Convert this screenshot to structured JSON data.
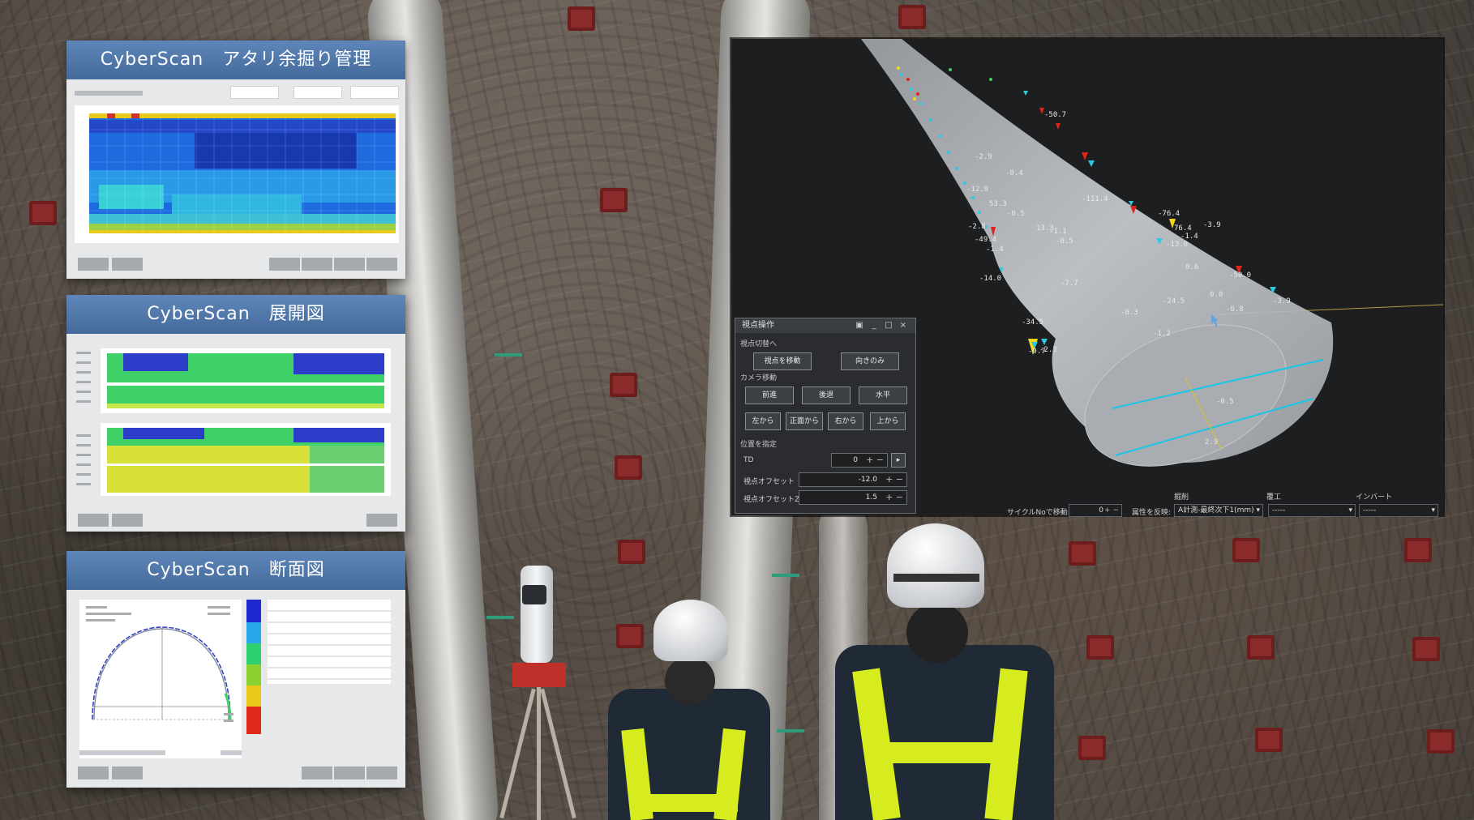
{
  "panels": {
    "management": {
      "title": "CyberScan　アタリ余掘り管理"
    },
    "development": {
      "title": "CyberScan　展開図"
    },
    "section": {
      "title": "CyberScan　断面図"
    }
  },
  "viewer": {
    "labels": [
      "-50.7",
      "-2.9",
      "-0.4",
      "-111.4",
      "-76.4",
      "53.3",
      "-0.5",
      "-3.9",
      "13.3",
      "-1.1",
      "-0.5",
      "-13.0",
      "76.4",
      "-1.4",
      "-12.9",
      "-2.8",
      "-49.4",
      "-1.4",
      "-14.0",
      "-7.7",
      "-24.5",
      "0.6",
      "-50.0",
      "0.0",
      "-3.9",
      "-6.8",
      "-0.3",
      "-1.2",
      "-34.5",
      "-9.7",
      "-2.3",
      "-0.5",
      "2.9"
    ],
    "header_labels": {
      "h1": "掘削",
      "h2": "覆工",
      "h3": "インバート"
    }
  },
  "control": {
    "title": "視点操作",
    "section_switch": "視点切替へ",
    "btn_move_view": "視点を移動",
    "btn_orient_only": "向きのみ",
    "section_camera": "カメラ移動",
    "btn_forward": "前進",
    "btn_back": "後退",
    "btn_level": "水平",
    "btn_left": "左から",
    "btn_front": "正面から",
    "btn_right": "右から",
    "btn_top": "上から",
    "section_position": "位置を指定",
    "td_label": "TD",
    "td_value": "0",
    "offset_label": "視点オフセット",
    "offset_value": "-12.0",
    "offsetz_label": "視点オフセットZ",
    "offsetz_value": "1.5"
  },
  "statusbar": {
    "cycle_label": "サイクルNoで移動:",
    "cycle_value": "0",
    "attr_label": "属性を反映:",
    "attr_value": "A計測-最終次下1(mm)",
    "dropdown2": "-----",
    "dropdown3": "-----"
  },
  "colors": {
    "panel_header": "#5076a8",
    "cyan_line": "#19c6e6",
    "marker_red": "#e0241b",
    "marker_yellow": "#f0d81a",
    "marker_cyan": "#2fc9e0"
  },
  "icons": [
    "minimize-icon",
    "maximize-icon",
    "close-icon",
    "pin-icon",
    "plus-icon",
    "minus-icon",
    "chevron-down-icon",
    "cursor-icon"
  ]
}
